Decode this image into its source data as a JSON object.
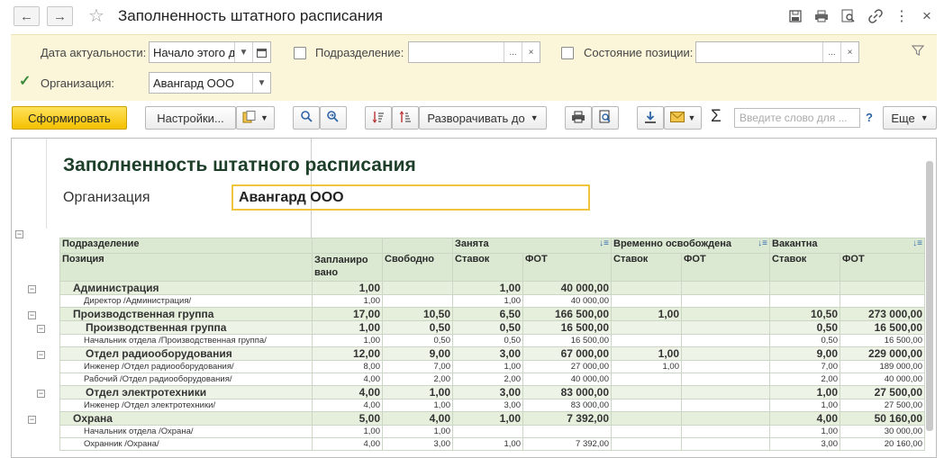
{
  "window": {
    "title": "Заполненность штатного расписания"
  },
  "filters": {
    "date_label": "Дата актуальности:",
    "date_value": "Начало этого д",
    "department_label": "Подразделение:",
    "department_value": "",
    "position_state_label": "Состояние позиции:",
    "position_state_value": "",
    "organization_label": "Организация:",
    "organization_value": "Авангард ООО",
    "organization_checked": true,
    "ellipsis": "...",
    "clear": "×"
  },
  "toolbar": {
    "generate": "Сформировать",
    "settings": "Настройки...",
    "expand_to": "Разворачивать до",
    "search_placeholder": "Введите слово для ...",
    "help": "?",
    "more": "Еще",
    "sum": "Σ"
  },
  "report": {
    "title": "Заполненность штатного расписания",
    "org_label": "Организация",
    "org_value": "Авангард ООО",
    "headers": {
      "department": "Подразделение",
      "position": "Позиция",
      "planned": "Запланиро вано",
      "free": "Свободно",
      "occupied": "Занята",
      "temp_released": "Временно освобождена",
      "vacant": "Вакантна",
      "rates": "Ставок",
      "fot": "ФОТ"
    },
    "rows": [
      {
        "level": 1,
        "name": "Администрация",
        "planned": "1,00",
        "free": "",
        "occ_rates": "1,00",
        "occ_fot": "40 000,00",
        "tmp_rates": "",
        "tmp_fot": "",
        "vac_rates": "",
        "vac_fot": ""
      },
      {
        "level": 3,
        "name": "Директор /Администрация/",
        "planned": "1,00",
        "free": "",
        "occ_rates": "1,00",
        "occ_fot": "40 000,00",
        "tmp_rates": "",
        "tmp_fot": "",
        "vac_rates": "",
        "vac_fot": ""
      },
      {
        "level": 1,
        "name": "Производственная группа",
        "planned": "17,00",
        "free": "10,50",
        "occ_rates": "6,50",
        "occ_fot": "166 500,00",
        "tmp_rates": "1,00",
        "tmp_fot": "",
        "vac_rates": "10,50",
        "vac_fot": "273 000,00"
      },
      {
        "level": 2,
        "name": "Производственная группа",
        "planned": "1,00",
        "free": "0,50",
        "occ_rates": "0,50",
        "occ_fot": "16 500,00",
        "tmp_rates": "",
        "tmp_fot": "",
        "vac_rates": "0,50",
        "vac_fot": "16 500,00"
      },
      {
        "level": 3,
        "name": "Начальник отдела /Производственная группа/",
        "planned": "1,00",
        "free": "0,50",
        "occ_rates": "0,50",
        "occ_fot": "16 500,00",
        "tmp_rates": "",
        "tmp_fot": "",
        "vac_rates": "0,50",
        "vac_fot": "16 500,00"
      },
      {
        "level": 2,
        "name": "Отдел радиооборудования",
        "planned": "12,00",
        "free": "9,00",
        "occ_rates": "3,00",
        "occ_fot": "67 000,00",
        "tmp_rates": "1,00",
        "tmp_fot": "",
        "vac_rates": "9,00",
        "vac_fot": "229 000,00"
      },
      {
        "level": 3,
        "name": "Инженер /Отдел радиооборудования/",
        "planned": "8,00",
        "free": "7,00",
        "occ_rates": "1,00",
        "occ_fot": "27 000,00",
        "tmp_rates": "1,00",
        "tmp_fot": "",
        "vac_rates": "7,00",
        "vac_fot": "189 000,00"
      },
      {
        "level": 3,
        "name": "Рабочий /Отдел радиооборудования/",
        "planned": "4,00",
        "free": "2,00",
        "occ_rates": "2,00",
        "occ_fot": "40 000,00",
        "tmp_rates": "",
        "tmp_fot": "",
        "vac_rates": "2,00",
        "vac_fot": "40 000,00"
      },
      {
        "level": 2,
        "name": "Отдел электротехники",
        "planned": "4,00",
        "free": "1,00",
        "occ_rates": "3,00",
        "occ_fot": "83 000,00",
        "tmp_rates": "",
        "tmp_fot": "",
        "vac_rates": "1,00",
        "vac_fot": "27 500,00"
      },
      {
        "level": 3,
        "name": "Инженер /Отдел электротехники/",
        "planned": "4,00",
        "free": "1,00",
        "occ_rates": "3,00",
        "occ_fot": "83 000,00",
        "tmp_rates": "",
        "tmp_fot": "",
        "vac_rates": "1,00",
        "vac_fot": "27 500,00"
      },
      {
        "level": 1,
        "name": "Охрана",
        "planned": "5,00",
        "free": "4,00",
        "occ_rates": "1,00",
        "occ_fot": "7 392,00",
        "tmp_rates": "",
        "tmp_fot": "",
        "vac_rates": "4,00",
        "vac_fot": "50 160,00"
      },
      {
        "level": 3,
        "name": "Начальник отдела /Охрана/",
        "planned": "1,00",
        "free": "1,00",
        "occ_rates": "",
        "occ_fot": "",
        "tmp_rates": "",
        "tmp_fot": "",
        "vac_rates": "1,00",
        "vac_fot": "30 000,00"
      },
      {
        "level": 3,
        "name": "Охранник /Охрана/",
        "planned": "4,00",
        "free": "3,00",
        "occ_rates": "1,00",
        "occ_fot": "7 392,00",
        "tmp_rates": "",
        "tmp_fot": "",
        "vac_rates": "3,00",
        "vac_fot": "20 160,00"
      }
    ]
  }
}
